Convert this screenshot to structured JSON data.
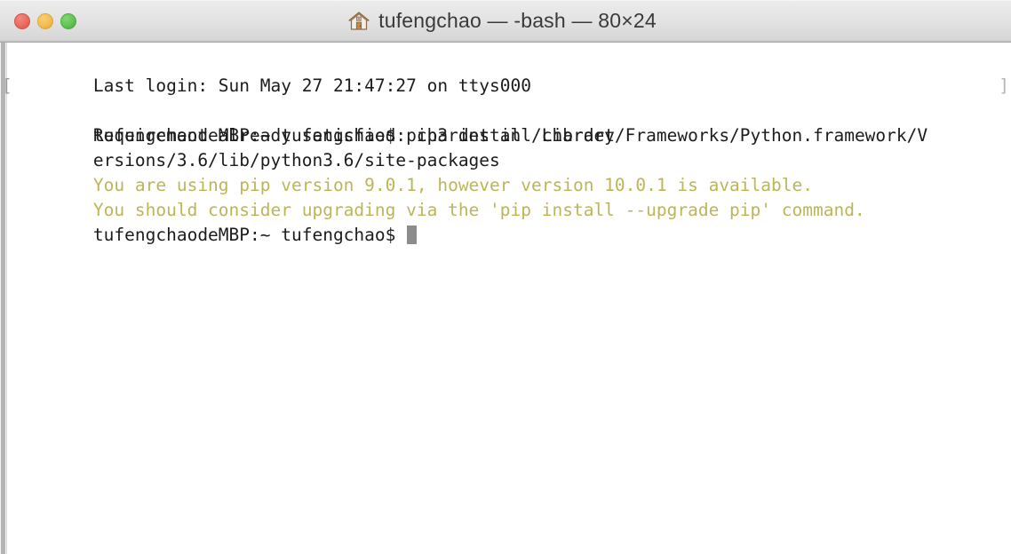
{
  "window": {
    "title": "tufengchao — -bash — 80×24",
    "icon": "house-icon",
    "controls": {
      "close_label": "Close",
      "minimize_label": "Minimize",
      "maximize_label": "Maximize"
    },
    "colors": {
      "close": "#ec6a5e",
      "minimize": "#f5bd4f",
      "maximize": "#61c454",
      "titlebar_top": "#ececec",
      "titlebar_bottom": "#d6d6d6",
      "terminal_background": "#ffffff",
      "terminal_foreground": "#1c1c1c",
      "warning_text": "#bcb657",
      "cursor": "#8c8c8c"
    },
    "dimensions": "80×24"
  },
  "terminal": {
    "lines": [
      {
        "text": "Last login: Sun May 27 21:47:27 on ttys000",
        "type": "normal"
      },
      {
        "text": "tufengchaodeMBP:~ tufengchao$ pip3 install chardet",
        "type": "normal",
        "paste_open": "[",
        "paste_close": "]"
      },
      {
        "text": "Requirement already satisfied: chardet in /Library/Frameworks/Python.framework/V",
        "type": "normal"
      },
      {
        "text": "ersions/3.6/lib/python3.6/site-packages",
        "type": "normal"
      },
      {
        "text": "You are using pip version 9.0.1, however version 10.0.1 is available.",
        "type": "warning"
      },
      {
        "text": "You should consider upgrading via the 'pip install --upgrade pip' command.",
        "type": "warning"
      }
    ],
    "prompt": "tufengchaodeMBP:~ tufengchao$ ",
    "cursor_visible": true
  }
}
